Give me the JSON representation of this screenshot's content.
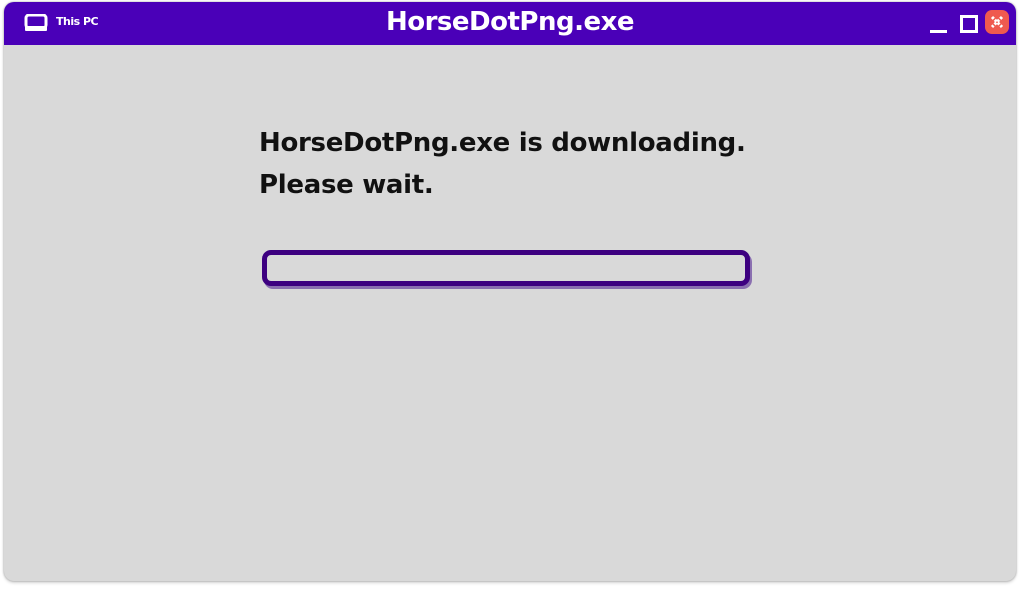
{
  "window": {
    "title": "HorseDotPng.exe",
    "location_label": "This PC",
    "accent_color": "#4a00b8",
    "background_color": "#d9d9d9",
    "close_button_color": "#ef5a4f"
  },
  "titlebar": {
    "icons": [
      "pc-icon",
      "minimize-icon",
      "maximize-icon",
      "close-icon"
    ]
  },
  "message": {
    "line1": "HorseDotPng.exe is downloading.",
    "line2": "Please wait."
  },
  "progress": {
    "value": 0,
    "border_color": "#3d0080"
  }
}
